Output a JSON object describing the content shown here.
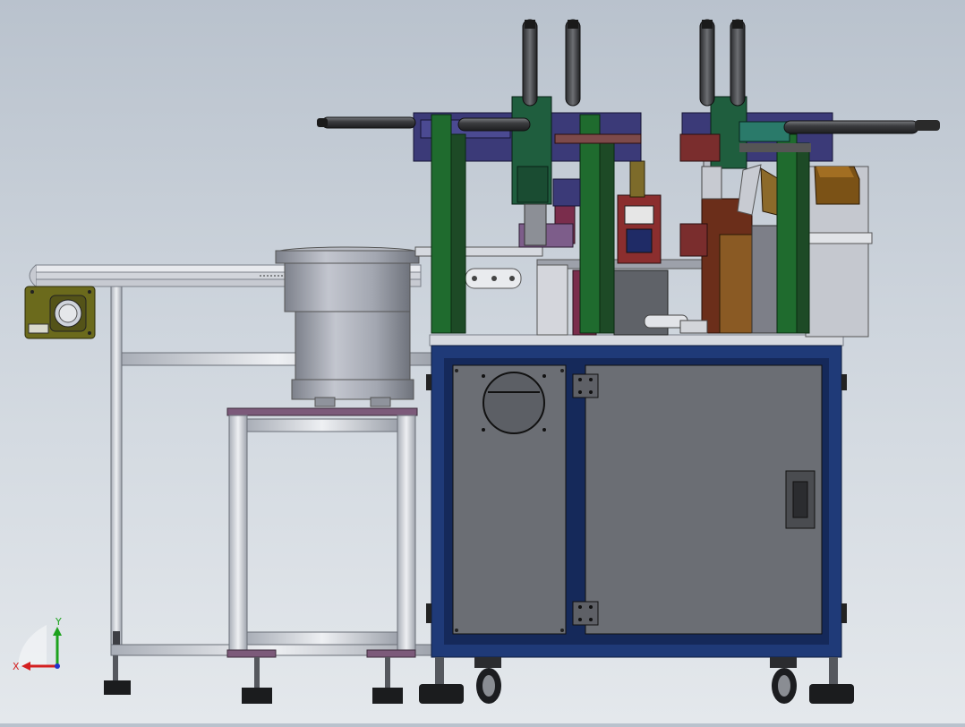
{
  "viewport": {
    "kind": "CAD 3D model view",
    "background_top": "#b9c2cd",
    "background_bottom": "#e4e8ec"
  },
  "triad": {
    "x_label": "X",
    "y_label": "Y",
    "x_color": "#d42020",
    "y_color": "#1da21d",
    "z_color": "#2233cc"
  },
  "colors": {
    "cabinet_frame": "#1f3a78",
    "cabinet_panel": "#6c6f74",
    "gantry_green": "#1f6b2e",
    "gantry_purple": "#3b3a78",
    "bowl_gray": "#9ea2ad",
    "frame_aluminum": "#c8ccd4"
  }
}
